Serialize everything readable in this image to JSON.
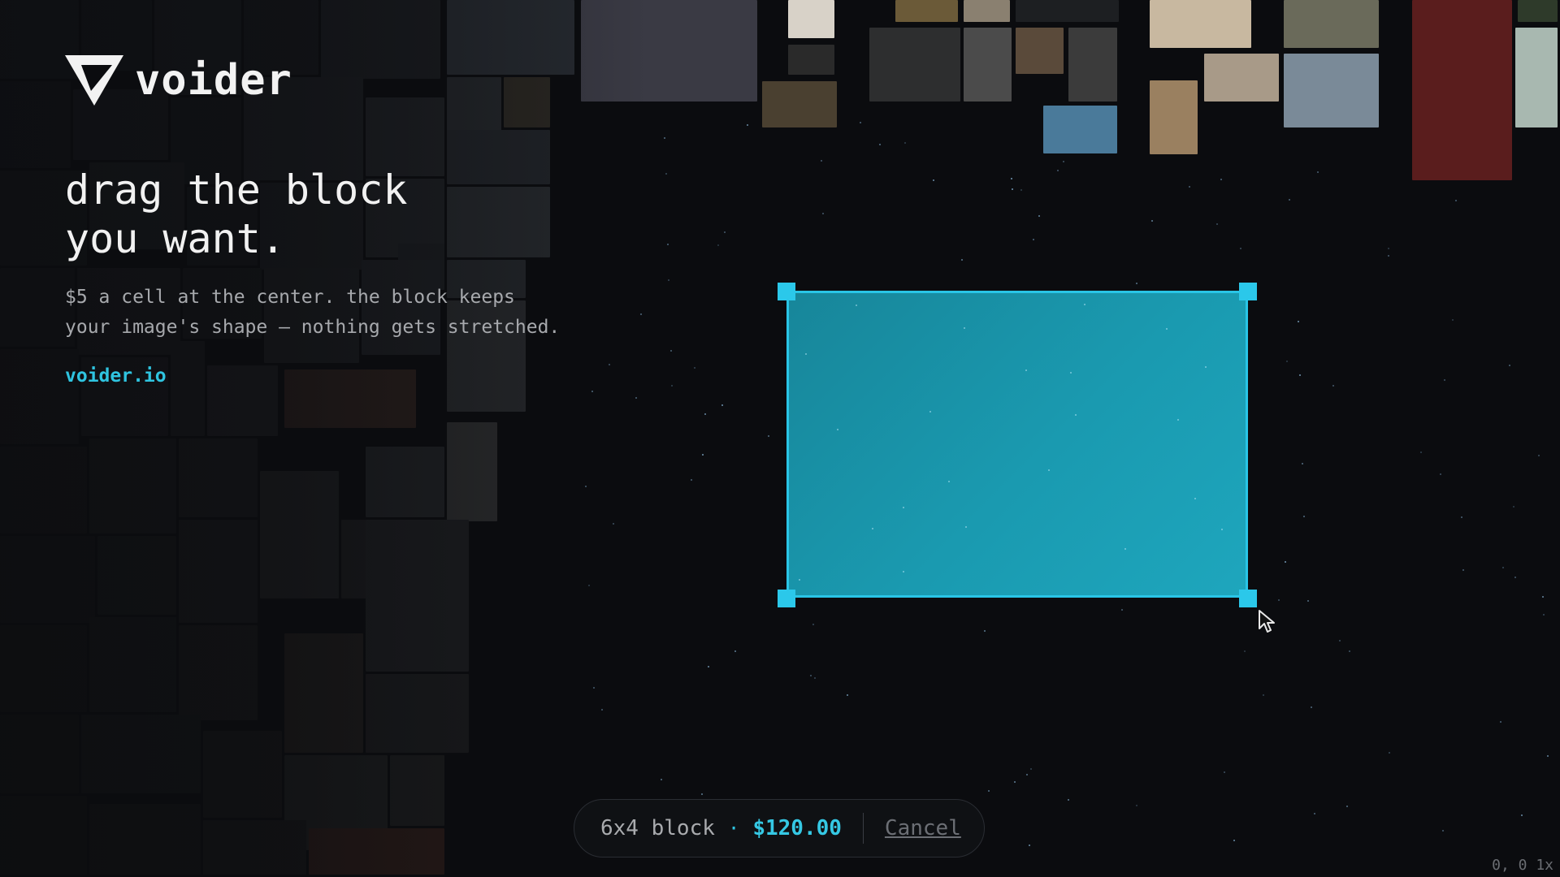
{
  "brand": {
    "name": "voider",
    "logo_icon": "triangle-v-logo"
  },
  "hero": {
    "headline_line1": "drag the block",
    "headline_line2": "you want.",
    "sub_line1": "$5 a cell at the center. the block keeps",
    "sub_line2": "your image's shape — nothing gets stretched.",
    "link": "voider.io"
  },
  "selection": {
    "size_label": "6x4 block",
    "separator": "·",
    "price": "$120.00",
    "cancel_label": "Cancel"
  },
  "status": {
    "coords": "0, 0 1x"
  },
  "colors": {
    "accent": "#29c5e6",
    "block_fill": "#1a9ab0",
    "background": "#0b0c0f"
  },
  "icons": {
    "cursor": "pointer-arrow-icon"
  }
}
